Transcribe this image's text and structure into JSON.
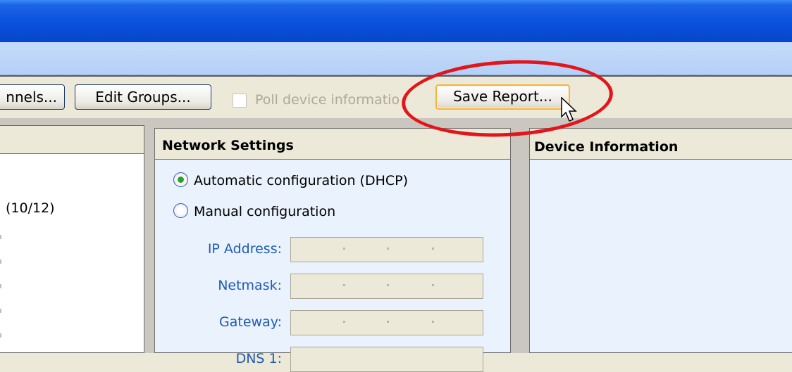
{
  "toolbar": {
    "channels_button": "nnels...",
    "edit_groups_button": "Edit Groups...",
    "poll_checkbox_label": "Poll device informatio",
    "save_report_button": "Save Report..."
  },
  "left_panel": {
    "count_text": "(10/12)"
  },
  "network_settings": {
    "title": "Network Settings",
    "dhcp_label": "Automatic configuration (DHCP)",
    "manual_label": "Manual configuration",
    "selected": "dhcp",
    "fields": [
      {
        "label": "IP Address:",
        "value": ""
      },
      {
        "label": "Netmask:",
        "value": ""
      },
      {
        "label": "Gateway:",
        "value": ""
      },
      {
        "label": "DNS 1:",
        "value": ""
      }
    ]
  },
  "device_information": {
    "title": "Device Information"
  },
  "colors": {
    "highlight_ellipse": "#e3151b",
    "titlebar": "#0a50dc",
    "field_label": "#1e5bb5",
    "radio_selected": "#29a22a"
  },
  "icons": [
    "cursor-arrow-icon",
    "radio-selected-icon",
    "radio-unselected-icon",
    "checkbox-icon"
  ]
}
